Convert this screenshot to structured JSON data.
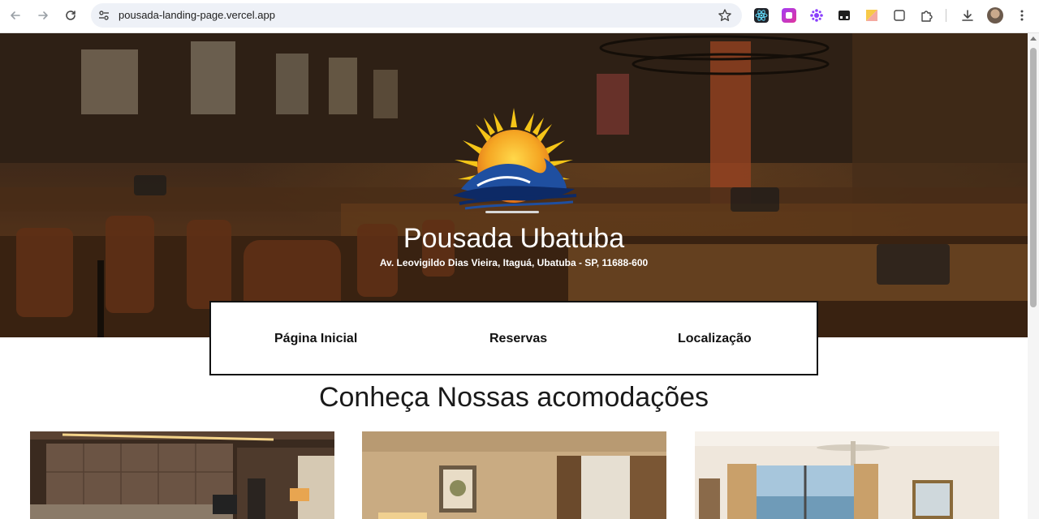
{
  "browser": {
    "url": "pousada-landing-page.vercel.app",
    "back_icon": "arrow-left-icon",
    "forward_icon": "arrow-right-icon",
    "reload_icon": "reload-icon",
    "extensions": [
      "react-devtools-icon",
      "extension-pink-icon",
      "extension-purple-icon",
      "extension-dark-icon",
      "extension-yellow-icon",
      "tab-search-icon",
      "puzzle-icon"
    ],
    "download_icon": "download-icon",
    "menu_icon": "kebab-menu-icon"
  },
  "hero": {
    "title": "Pousada Ubatuba",
    "address": "Av. Leovigildo Dias Vieira, Itaguá, Ubatuba - SP, 11688-600"
  },
  "nav": {
    "items": [
      {
        "label": "Página Inicial"
      },
      {
        "label": "Reservas"
      },
      {
        "label": "Localização"
      }
    ]
  },
  "accommodations": {
    "title": "Conheça Nossas acomodações",
    "cards": [
      {
        "image": "room-photo-1"
      },
      {
        "image": "room-photo-2"
      },
      {
        "image": "room-photo-3"
      }
    ]
  },
  "colors": {
    "sun_orange": "#f5a623",
    "wave_blue": "#1f4fa0",
    "wave_dark": "#0d2a66",
    "nav_border": "#111111"
  }
}
